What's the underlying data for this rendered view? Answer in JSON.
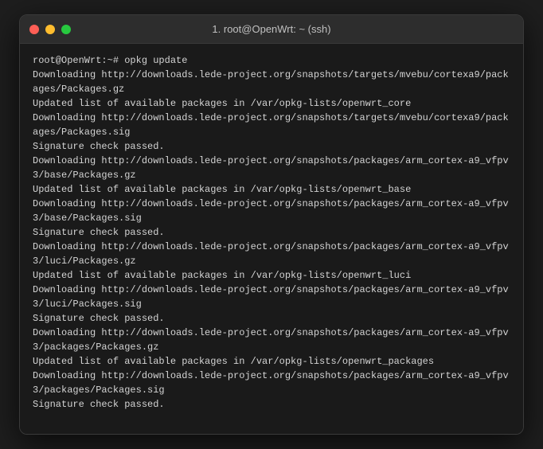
{
  "window": {
    "title": "1. root@OpenWrt: ~ (ssh)",
    "traffic_lights": {
      "close": "close",
      "minimize": "minimize",
      "maximize": "maximize"
    }
  },
  "terminal": {
    "lines": [
      "root@OpenWrt:~# opkg update",
      "Downloading http://downloads.lede-project.org/snapshots/targets/mvebu/cortexa9/packages/Packages.gz",
      "Updated list of available packages in /var/opkg-lists/openwrt_core",
      "Downloading http://downloads.lede-project.org/snapshots/targets/mvebu/cortexa9/packages/Packages.sig",
      "Signature check passed.",
      "Downloading http://downloads.lede-project.org/snapshots/packages/arm_cortex-a9_vfpv3/base/Packages.gz",
      "Updated list of available packages in /var/opkg-lists/openwrt_base",
      "Downloading http://downloads.lede-project.org/snapshots/packages/arm_cortex-a9_vfpv3/base/Packages.sig",
      "Signature check passed.",
      "Downloading http://downloads.lede-project.org/snapshots/packages/arm_cortex-a9_vfpv3/luci/Packages.gz",
      "Updated list of available packages in /var/opkg-lists/openwrt_luci",
      "Downloading http://downloads.lede-project.org/snapshots/packages/arm_cortex-a9_vfpv3/luci/Packages.sig",
      "Signature check passed.",
      "Downloading http://downloads.lede-project.org/snapshots/packages/arm_cortex-a9_vfpv3/packages/Packages.gz",
      "Updated list of available packages in /var/opkg-lists/openwrt_packages",
      "Downloading http://downloads.lede-project.org/snapshots/packages/arm_cortex-a9_vfpv3/packages/Packages.sig",
      "Signature check passed."
    ]
  }
}
